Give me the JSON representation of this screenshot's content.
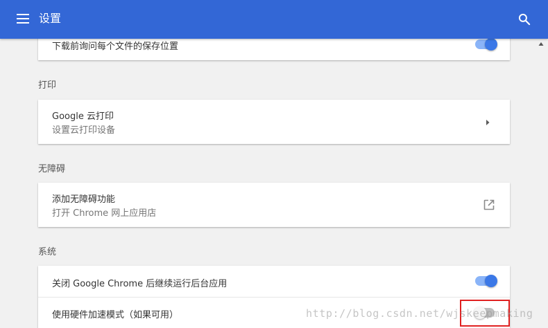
{
  "header": {
    "title": "设置",
    "menu_icon": "hamburger-menu-icon",
    "search_icon": "search-icon",
    "color": "#3367d6"
  },
  "download": {
    "ask_location_label": "下载前询问每个文件的保存位置",
    "ask_location_enabled": true
  },
  "print": {
    "section_label": "打印",
    "cloud_print_title": "Google 云打印",
    "cloud_print_subtitle": "设置云打印设备"
  },
  "accessibility": {
    "section_label": "无障碍",
    "add_features_title": "添加无障碍功能",
    "add_features_subtitle": "打开 Chrome 网上应用店"
  },
  "system": {
    "section_label": "系统",
    "background_apps_label": "关闭 Google Chrome 后继续运行后台应用",
    "background_apps_enabled": true,
    "hardware_accel_label": "使用硬件加速模式（如果可用）",
    "hardware_accel_enabled": false
  },
  "watermark": {
    "text": "http://blog.csdn.net/wjskeepmaking"
  },
  "colors": {
    "accent": "#3b78e7",
    "highlight_border": "#e02020"
  }
}
